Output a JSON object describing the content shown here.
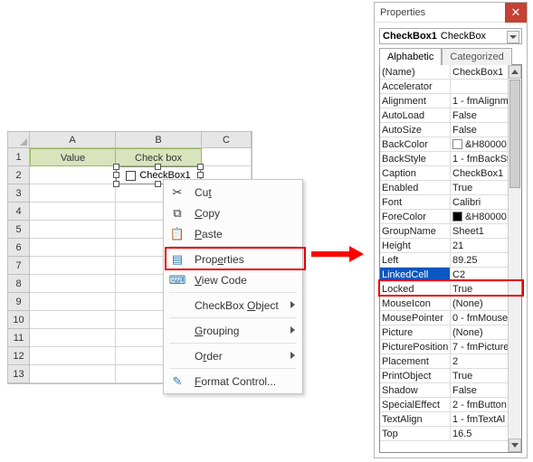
{
  "sheet": {
    "columns": [
      "A",
      "B",
      "C"
    ],
    "row_count": 13,
    "headers": {
      "A1": "Value",
      "B1": "Check box"
    },
    "checkbox_label": "CheckBox1"
  },
  "context_menu": {
    "cut": "Cut",
    "copy": "Copy",
    "paste": "Paste",
    "properties": "Properties",
    "view_code": "View Code",
    "checkbox_object": "CheckBox Object",
    "grouping": "Grouping",
    "order": "Order",
    "format_control": "Format Control..."
  },
  "properties_panel": {
    "title": "Properties",
    "object_name": "CheckBox1",
    "object_type": "CheckBox",
    "tabs": {
      "alphabetic": "Alphabetic",
      "categorized": "Categorized"
    },
    "rows": [
      {
        "k": "(Name)",
        "v": "CheckBox1"
      },
      {
        "k": "Accelerator",
        "v": ""
      },
      {
        "k": "Alignment",
        "v": "1 - fmAlignm"
      },
      {
        "k": "AutoLoad",
        "v": "False"
      },
      {
        "k": "AutoSize",
        "v": "False"
      },
      {
        "k": "BackColor",
        "v": "&H80000",
        "swatch": "white"
      },
      {
        "k": "BackStyle",
        "v": "1 - fmBackSt"
      },
      {
        "k": "Caption",
        "v": "CheckBox1"
      },
      {
        "k": "Enabled",
        "v": "True"
      },
      {
        "k": "Font",
        "v": "Calibri"
      },
      {
        "k": "ForeColor",
        "v": "&H80000",
        "swatch": "black"
      },
      {
        "k": "GroupName",
        "v": "Sheet1"
      },
      {
        "k": "Height",
        "v": "21"
      },
      {
        "k": "Left",
        "v": "89.25"
      },
      {
        "k": "LinkedCell",
        "v": "C2",
        "selected": true
      },
      {
        "k": "Locked",
        "v": "True"
      },
      {
        "k": "MouseIcon",
        "v": "(None)"
      },
      {
        "k": "MousePointer",
        "v": "0 - fmMouse"
      },
      {
        "k": "Picture",
        "v": "(None)"
      },
      {
        "k": "PicturePosition",
        "v": "7 - fmPicture"
      },
      {
        "k": "Placement",
        "v": "2"
      },
      {
        "k": "PrintObject",
        "v": "True"
      },
      {
        "k": "Shadow",
        "v": "False"
      },
      {
        "k": "SpecialEffect",
        "v": "2 - fmButton"
      },
      {
        "k": "TextAlign",
        "v": "1 - fmTextAl"
      },
      {
        "k": "Top",
        "v": "16.5"
      }
    ]
  }
}
